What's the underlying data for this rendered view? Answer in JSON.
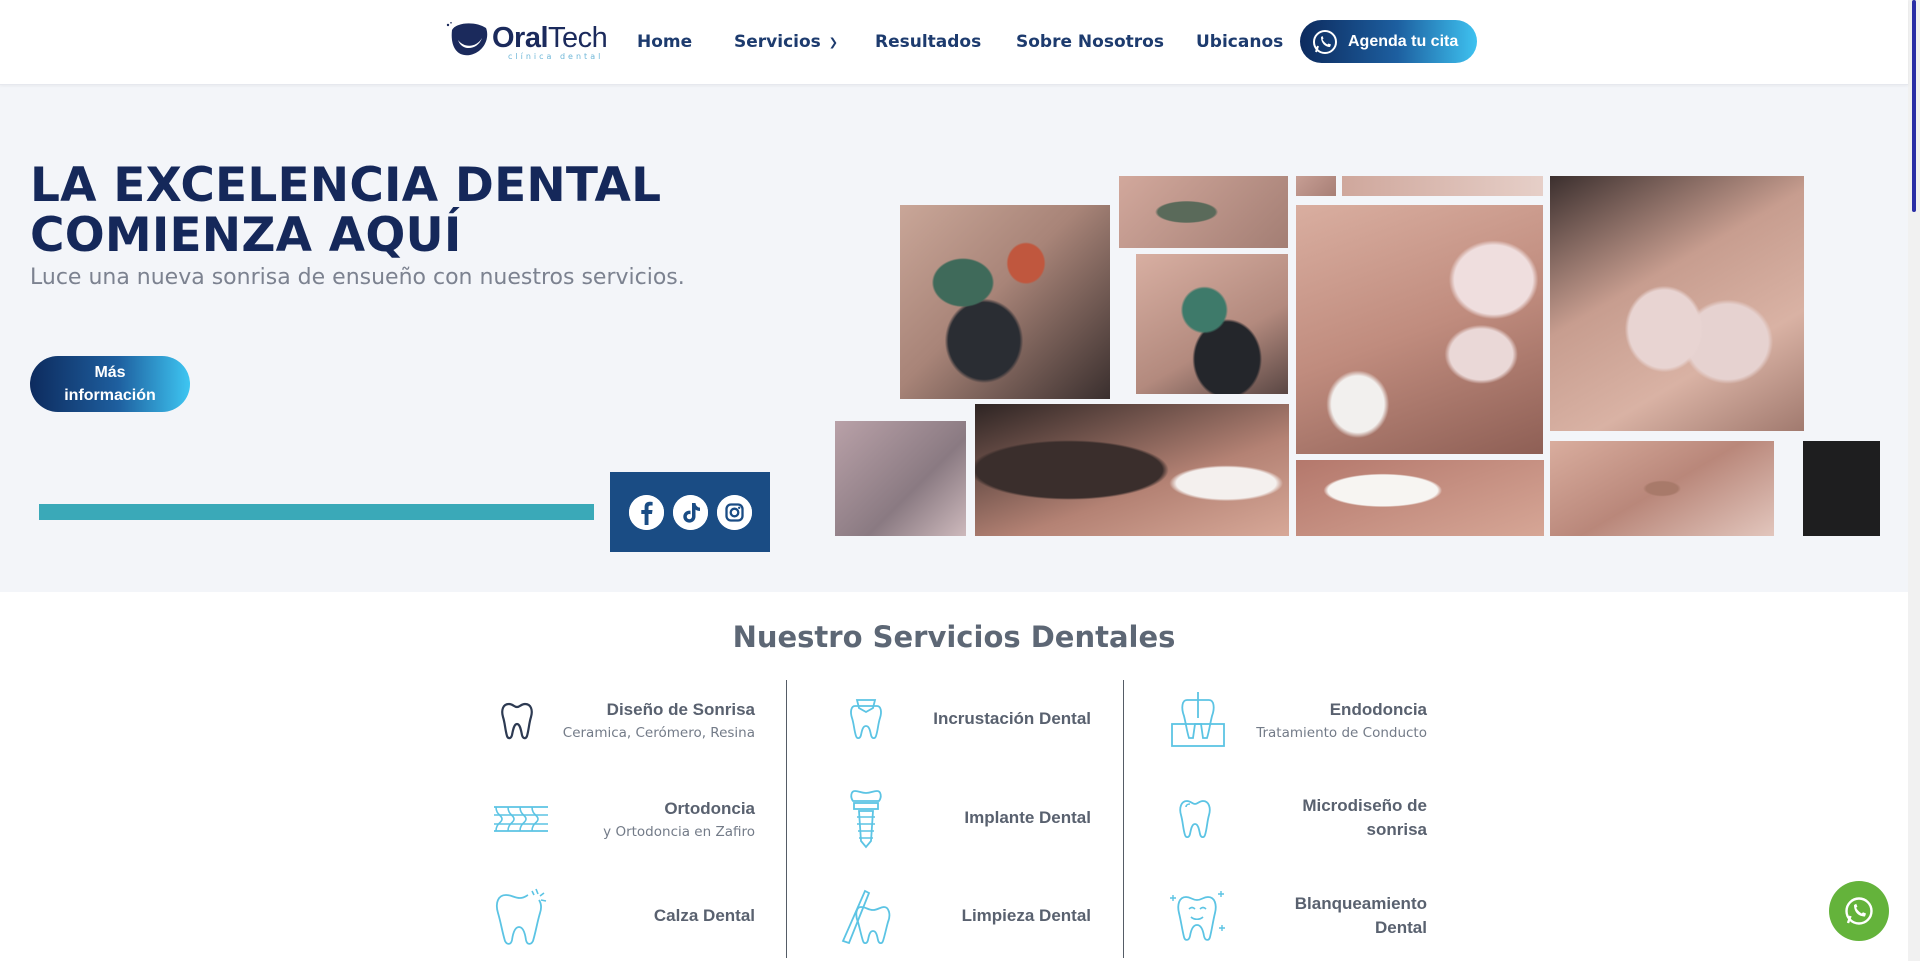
{
  "header": {
    "logo_text_bold": "Oral",
    "logo_text_light": "Tech",
    "logo_tagline": "clínica dental",
    "nav": [
      {
        "label": "Home"
      },
      {
        "label": "Servicios"
      },
      {
        "label": "Resultados"
      },
      {
        "label": "Sobre Nosotros"
      },
      {
        "label": "Ubicanos"
      }
    ],
    "cta_label": "Agenda tu cita"
  },
  "hero": {
    "title_line1": "LA EXCELENCIA DENTAL",
    "title_line2": "COMIENZA AQUÍ",
    "subtitle": "Luce una nueva sonrisa de ensueño con nuestros servicios.",
    "button_line1": "Más",
    "button_line2": "información"
  },
  "social": [
    "facebook-icon",
    "tiktok-icon",
    "instagram-icon"
  ],
  "services": {
    "title": "Nuestro Servicios Dentales",
    "items": [
      {
        "name": "Diseño de Sonrisa",
        "desc": "Ceramica, Cerómero, Resina",
        "icon": "tooth-outline-icon"
      },
      {
        "name": "Incrustación Dental",
        "desc": "",
        "icon": "tooth-inlay-icon"
      },
      {
        "name": "Endodoncia",
        "desc": "Tratamiento de Conducto",
        "icon": "root-canal-icon"
      },
      {
        "name": "Ortodoncia",
        "desc": "y Ortodoncia en Zafiro",
        "icon": "braces-icon"
      },
      {
        "name": "Implante Dental",
        "desc": "",
        "icon": "implant-icon"
      },
      {
        "name": "Microdiseño de",
        "name2": "sonrisa",
        "desc": "",
        "icon": "tooth-icon"
      },
      {
        "name": "Calza Dental",
        "desc": "",
        "icon": "cavity-tooth-icon"
      },
      {
        "name": "Limpieza Dental",
        "desc": "",
        "icon": "cleaning-icon"
      },
      {
        "name": "Blanqueamiento",
        "name2": "Dental",
        "desc": "",
        "icon": "whitening-icon"
      }
    ]
  },
  "colors": {
    "navy": "#15285a",
    "teal": "#3aa9b8",
    "social_bg": "#1a4c84",
    "accent_light": "#5cc4e4",
    "whatsapp": "#64b33b"
  }
}
